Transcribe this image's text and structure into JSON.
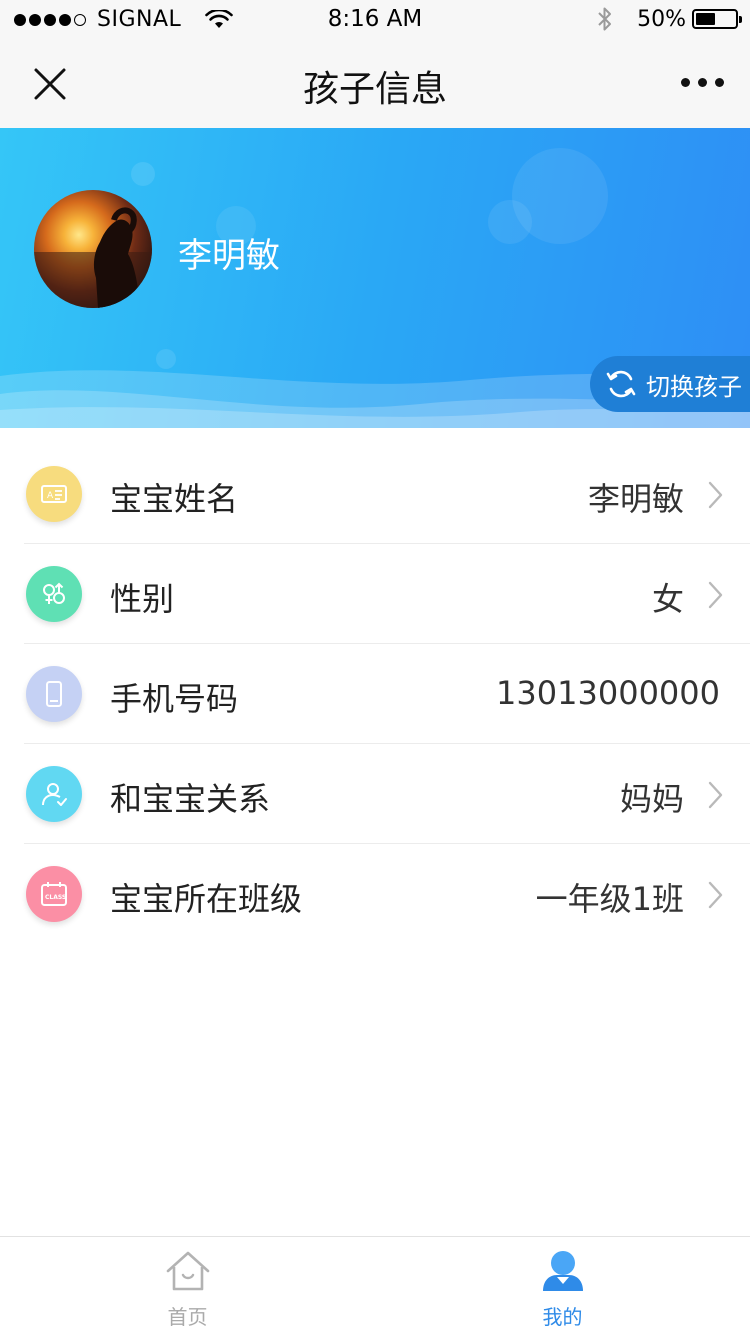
{
  "status_bar": {
    "carrier": "SIGNAL",
    "time": "8:16 AM",
    "battery": "50%",
    "battery_level": 0.5,
    "signal_bars_filled": 4,
    "signal_bars_total": 5
  },
  "nav": {
    "title": "孩子信息",
    "close_icon": "close-icon",
    "more_icon": "more-dots-icon"
  },
  "banner": {
    "child_name": "李明敏",
    "switch_label": "切换孩子",
    "switch_icon": "refresh-icon"
  },
  "rows": [
    {
      "label": "宝宝姓名",
      "value": "李明敏",
      "icon": "id-card-icon",
      "color": "#f7dc7e",
      "has_arrow": true
    },
    {
      "label": "性别",
      "value": "女",
      "icon": "gender-icon",
      "color": "#5fe0b4",
      "has_arrow": true
    },
    {
      "label": "手机号码",
      "value": "13013000000",
      "icon": "phone-icon",
      "color": "#c5d1f4",
      "has_arrow": false
    },
    {
      "label": "和宝宝关系",
      "value": "妈妈",
      "icon": "relation-icon",
      "color": "#61d8f2",
      "has_arrow": true
    },
    {
      "label": "宝宝所在班级",
      "value": "一年级1班",
      "icon": "class-calendar-icon",
      "color": "#fb8fa5",
      "has_arrow": true
    }
  ],
  "tabs": [
    {
      "label": "首页",
      "icon": "home-icon",
      "active": false
    },
    {
      "label": "我的",
      "icon": "user-icon",
      "active": true
    }
  ],
  "colors": {
    "accent": "#2f8be8",
    "banner_start": "#35c6f7",
    "banner_end": "#2e8ef5"
  }
}
